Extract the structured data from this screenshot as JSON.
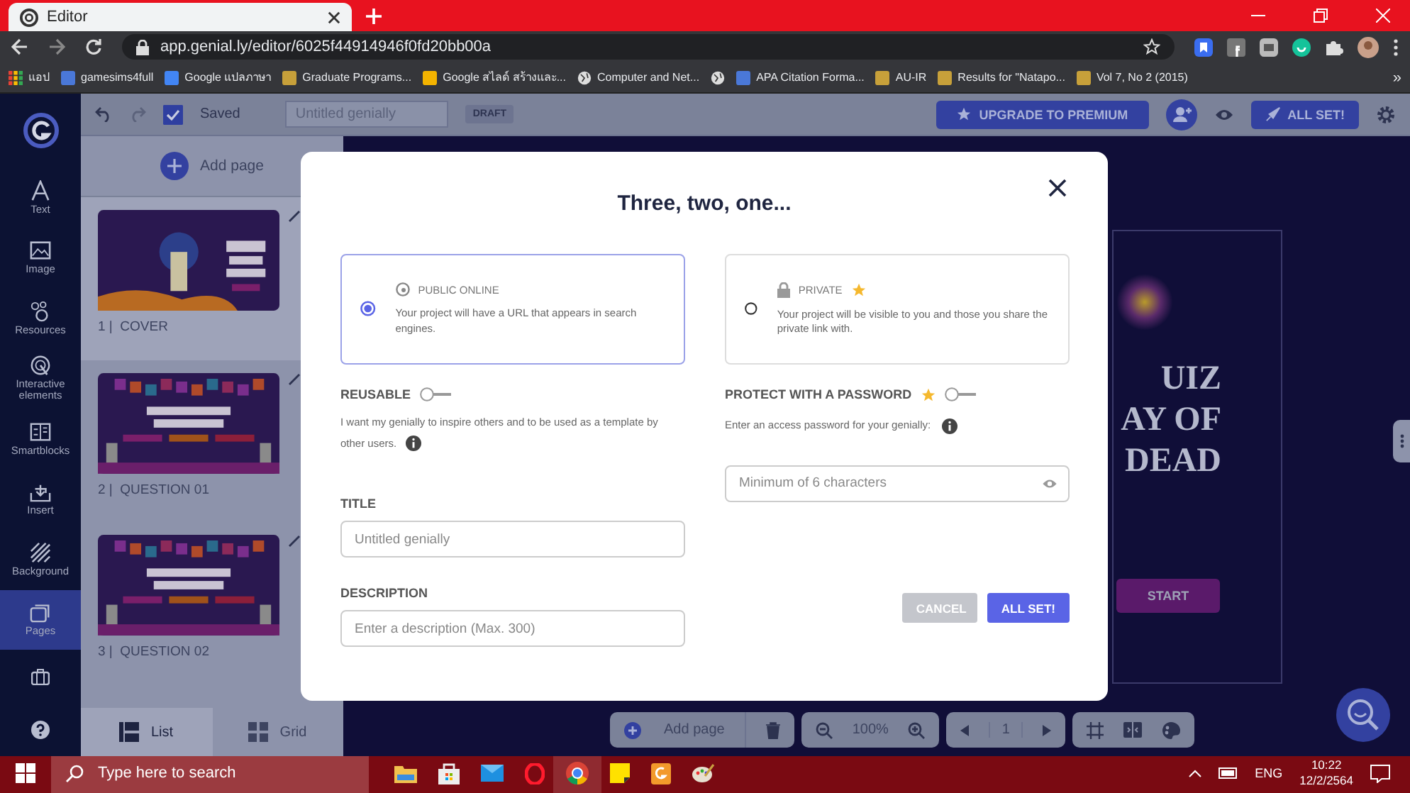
{
  "browser": {
    "tab_title": "Editor",
    "url": "app.genial.ly/editor/6025f44914946f0fd20bb00a",
    "bookmarks": [
      {
        "label": "แอป",
        "kind": "apps"
      },
      {
        "label": "gamesims4full",
        "kind": "site"
      },
      {
        "label": "Google แปลภาษา",
        "kind": "translate"
      },
      {
        "label": "Graduate Programs...",
        "kind": "seal"
      },
      {
        "label": "Google สไลด์ สร้างและ...",
        "kind": "slides"
      },
      {
        "label": "Computer and Net...",
        "kind": "globe"
      },
      {
        "kind": "globe"
      },
      {
        "label": "APA Citation Forma...",
        "kind": "site"
      },
      {
        "label": "AU-IR",
        "kind": "seal"
      },
      {
        "label": "Results for \"Natapo...",
        "kind": "seal"
      },
      {
        "label": "Vol 7, No 2 (2015)",
        "kind": "seal"
      }
    ],
    "more": "»"
  },
  "sidebar": {
    "items": [
      {
        "label": "Text",
        "kind": "text",
        "selected": false
      },
      {
        "label": "Image",
        "kind": "image",
        "selected": false
      },
      {
        "label": "Resources",
        "kind": "resources",
        "selected": false
      },
      {
        "label": "Interactive elements",
        "kind": "interactive",
        "selected": false
      },
      {
        "label": "Smartblocks",
        "kind": "smartblocks",
        "selected": false
      },
      {
        "label": "Insert",
        "kind": "insert",
        "selected": false
      },
      {
        "label": "Background",
        "kind": "background",
        "selected": false
      },
      {
        "label": "Pages",
        "kind": "pages",
        "selected": true
      }
    ]
  },
  "toolbar": {
    "saved": true,
    "save_status": "Saved",
    "title_placeholder": "Untitled genially",
    "badge": "DRAFT",
    "upgrade_label": "UPGRADE TO PREMIUM",
    "publish_label": "ALL SET!"
  },
  "pages_panel": {
    "add_label": "Add page",
    "pages": [
      {
        "label": "1 |  COVER",
        "kind": "cover",
        "selected": true
      },
      {
        "label": "2 |  QUESTION 01",
        "kind": "question",
        "selected": false
      },
      {
        "label": "3 |  QUESTION 02",
        "kind": "question",
        "selected": false
      }
    ],
    "view_tabs": [
      {
        "label": "List",
        "kind": "list",
        "selected": true
      },
      {
        "label": "Grid",
        "kind": "grid",
        "selected": false
      }
    ]
  },
  "canvas": {
    "slide_texts": [
      "UIZ",
      "AY OF",
      "DEAD"
    ],
    "start_label": "START",
    "add_label": "Add page",
    "zoom": "100%",
    "page_number": "1"
  },
  "dialog": {
    "title": "Three, two, one...",
    "visibility_options": [
      {
        "kind": "public",
        "label": "PUBLIC ONLINE",
        "premium": false,
        "selected": true,
        "description": "Your project will have a URL that appears in search engines."
      },
      {
        "kind": "private",
        "label": "PRIVATE",
        "premium": true,
        "selected": false,
        "description": "Your project will be visible to you and those you share the private link with."
      }
    ],
    "reusable": {
      "label": "REUSABLE",
      "on": false,
      "help": "I want my genially to inspire others and to be used as a template by other users."
    },
    "password": {
      "label": "PROTECT WITH A PASSWORD",
      "premium": true,
      "on": false,
      "help": "Enter an access password for your genially:",
      "placeholder": "Minimum of 6 characters"
    },
    "title_field": {
      "label": "TITLE",
      "placeholder": "Untitled genially"
    },
    "description_field": {
      "label": "DESCRIPTION",
      "placeholder": "Enter a description (Max. 300)"
    },
    "buttons": [
      {
        "label": "CANCEL",
        "kind": "secondary"
      },
      {
        "label": "ALL SET!",
        "kind": "primary"
      }
    ]
  },
  "taskbar": {
    "search_placeholder": "Type here to search",
    "language": "ENG",
    "time": "10:22",
    "date": "12/2/2564"
  }
}
